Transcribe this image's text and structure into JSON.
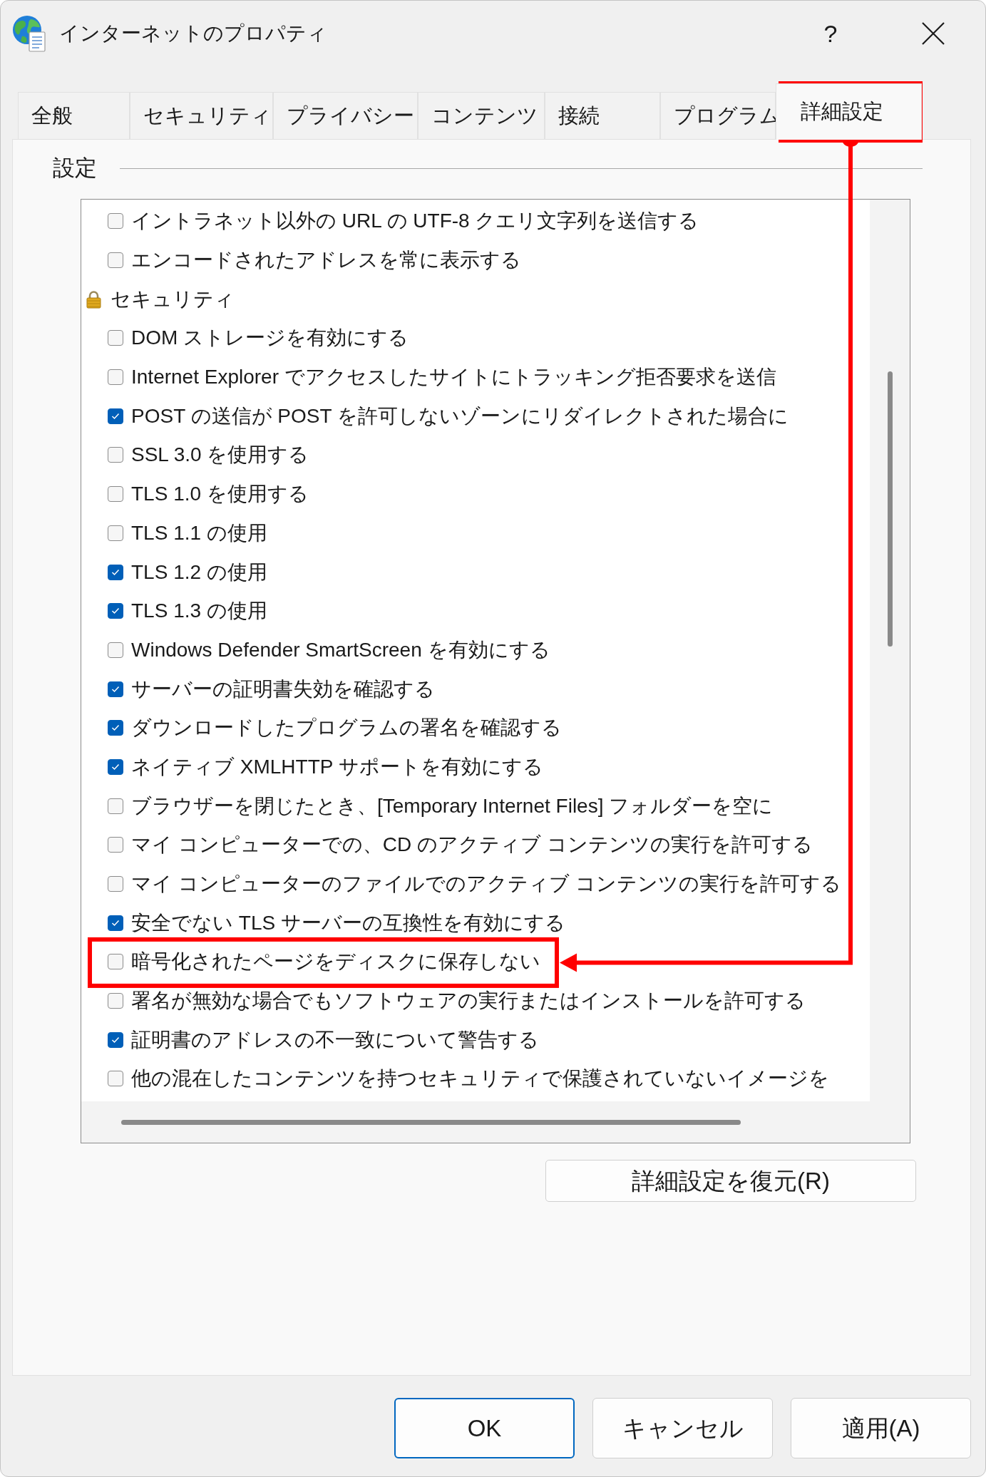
{
  "window": {
    "title": "インターネットのプロパティ",
    "help_button": "?"
  },
  "tabs": [
    {
      "label": "全般",
      "selected": false,
      "highlighted": false
    },
    {
      "label": "セキュリティ",
      "selected": false,
      "highlighted": false
    },
    {
      "label": "プライバシー",
      "selected": false,
      "highlighted": false
    },
    {
      "label": "コンテンツ",
      "selected": false,
      "highlighted": false
    },
    {
      "label": "接続",
      "selected": false,
      "highlighted": false
    },
    {
      "label": "プログラム",
      "selected": false,
      "highlighted": false
    },
    {
      "label": "詳細設定",
      "selected": true,
      "highlighted": true
    }
  ],
  "settings": {
    "group_label": "設定",
    "items": [
      {
        "kind": "checkbox",
        "label": "イントラネット以外の URL の UTF-8 クエリ文字列を送信する",
        "checked": false,
        "highlighted": false
      },
      {
        "kind": "checkbox",
        "label": "エンコードされたアドレスを常に表示する",
        "checked": false,
        "highlighted": false
      },
      {
        "kind": "group",
        "label": "セキュリティ",
        "children": [
          {
            "kind": "checkbox",
            "label": "DOM ストレージを有効にする",
            "checked": false,
            "highlighted": false
          },
          {
            "kind": "checkbox",
            "label": "Internet Explorer でアクセスしたサイトにトラッキング拒否要求を送信",
            "checked": false,
            "highlighted": false
          },
          {
            "kind": "checkbox",
            "label": "POST の送信が POST を許可しないゾーンにリダイレクトされた場合に",
            "checked": true,
            "highlighted": false
          },
          {
            "kind": "checkbox",
            "label": "SSL 3.0 を使用する",
            "checked": false,
            "highlighted": false
          },
          {
            "kind": "checkbox",
            "label": "TLS 1.0 を使用する",
            "checked": false,
            "highlighted": false
          },
          {
            "kind": "checkbox",
            "label": "TLS 1.1 の使用",
            "checked": false,
            "highlighted": false
          },
          {
            "kind": "checkbox",
            "label": "TLS 1.2 の使用",
            "checked": true,
            "highlighted": false
          },
          {
            "kind": "checkbox",
            "label": "TLS 1.3 の使用",
            "checked": true,
            "highlighted": false
          },
          {
            "kind": "checkbox",
            "label": "Windows Defender SmartScreen を有効にする",
            "checked": false,
            "highlighted": false
          },
          {
            "kind": "checkbox",
            "label": "サーバーの証明書失効を確認する",
            "checked": true,
            "highlighted": false
          },
          {
            "kind": "checkbox",
            "label": "ダウンロードしたプログラムの署名を確認する",
            "checked": true,
            "highlighted": false
          },
          {
            "kind": "checkbox",
            "label": "ネイティブ XMLHTTP サポートを有効にする",
            "checked": true,
            "highlighted": false
          },
          {
            "kind": "checkbox",
            "label": "ブラウザーを閉じたとき、[Temporary Internet Files] フォルダーを空に",
            "checked": false,
            "highlighted": false
          },
          {
            "kind": "checkbox",
            "label": "マイ コンピューターでの、CD のアクティブ コンテンツの実行を許可する",
            "checked": false,
            "highlighted": false
          },
          {
            "kind": "checkbox",
            "label": "マイ コンピューターのファイルでのアクティブ コンテンツの実行を許可する",
            "checked": false,
            "highlighted": false
          },
          {
            "kind": "checkbox",
            "label": "安全でない TLS サーバーの互換性を有効にする",
            "checked": true,
            "highlighted": false
          },
          {
            "kind": "checkbox",
            "label": "暗号化されたページをディスクに保存しない",
            "checked": false,
            "highlighted": true
          },
          {
            "kind": "checkbox",
            "label": "署名が無効な場合でもソフトウェアの実行またはインストールを許可する",
            "checked": false,
            "highlighted": false
          },
          {
            "kind": "checkbox",
            "label": "証明書のアドレスの不一致について警告する",
            "checked": true,
            "highlighted": false
          },
          {
            "kind": "checkbox",
            "label": "他の混在したコンテンツを持つセキュリティで保護されていないイメージを",
            "checked": false,
            "highlighted": false
          }
        ]
      }
    ]
  },
  "restore_button": "詳細設定を復元(R)",
  "buttons": [
    {
      "label": "OK",
      "default": true
    },
    {
      "label": "キャンセル",
      "default": false
    },
    {
      "label": "適用(A)",
      "default": false
    }
  ]
}
